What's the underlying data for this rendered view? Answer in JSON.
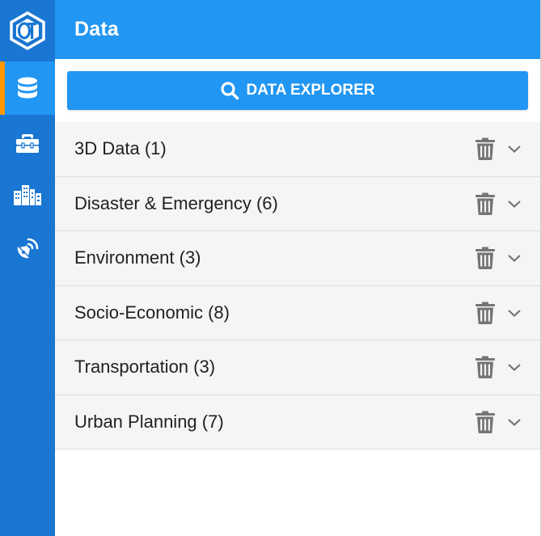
{
  "rail": {
    "logo_icon": "ot-hexagon-logo-icon",
    "items": [
      {
        "icon": "database-icon",
        "active": true
      },
      {
        "icon": "toolbox-icon",
        "active": false
      },
      {
        "icon": "city-buildings-icon",
        "active": false
      },
      {
        "icon": "satellite-dish-icon",
        "active": false
      }
    ],
    "colors": {
      "rail_bg": "#1976d2",
      "active_bg": "#2196f3",
      "active_indicator": "#ff9800"
    }
  },
  "panel": {
    "title": "Data",
    "explorer_button_label": "DATA EXPLORER",
    "explorer_icon": "search-icon"
  },
  "categories": [
    {
      "label": "3D Data (1)"
    },
    {
      "label": "Disaster & Emergency (6)"
    },
    {
      "label": "Environment (3)"
    },
    {
      "label": "Socio-Economic (8)"
    },
    {
      "label": "Transportation (3)"
    },
    {
      "label": "Urban Planning (7)"
    }
  ],
  "colors": {
    "accent": "#2196f3",
    "row_bg": "#f5f5f5",
    "icon_grey": "#757575"
  }
}
